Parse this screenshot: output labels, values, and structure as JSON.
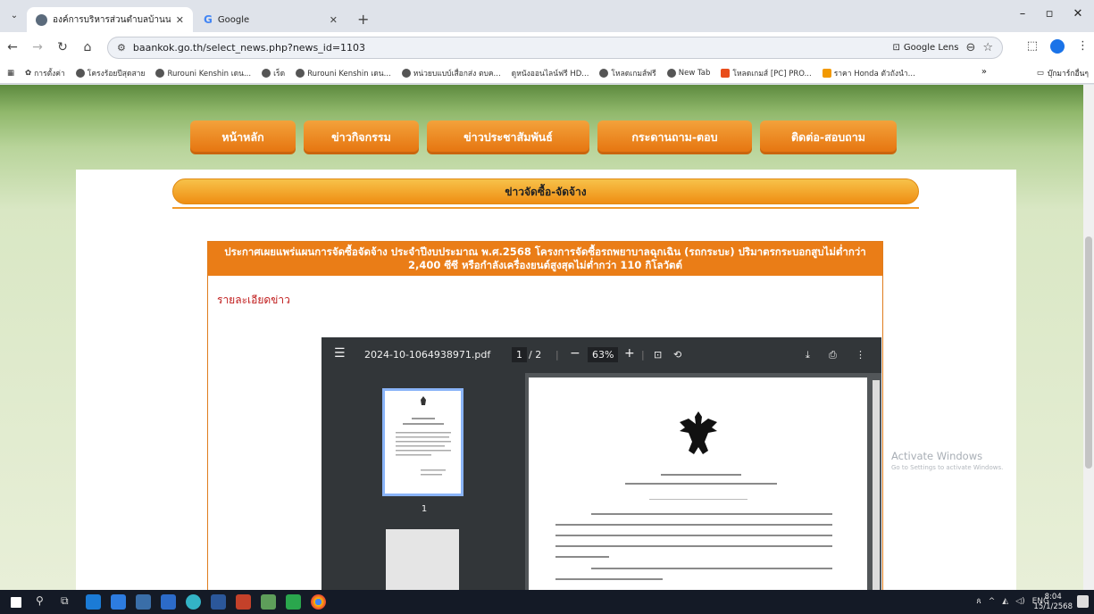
{
  "browser": {
    "tabs": [
      {
        "title": "องค์การบริหารส่วนตำบลบ้านนอก อ.",
        "active": true
      },
      {
        "title": "Google",
        "active": false
      }
    ],
    "url": "baankok.go.th/select_news.php?news_id=1103",
    "lens_label": "Google Lens",
    "bookmarks": [
      "การตั้งค่า",
      "โครงร้อยปีสุดสาย",
      "Rurouni Kenshin เดน...",
      "เร็ด",
      "Rurouni Kenshin เดน...",
      "หน่วยบแบบ์เสื่อกส่ง ตบค...",
      "ดูหนังออนไลน์ฟรี HD...",
      "โหลดเกมส์ฟรี",
      "New Tab",
      "โหลดเกมส์ [PC] PRO...",
      "ราคา Honda ตัวถังนำ..."
    ],
    "bookmarks_more": "»",
    "bookmarks_folder": "บุ๊กมาร์กอื่นๆ"
  },
  "site": {
    "menu": [
      "หน้าหลัก",
      "ข่าวกิจกรรม",
      "ข่าวประชาสัมพันธ์",
      "กระดานถาม-ตอบ",
      "ติดต่อ-สอบถาม"
    ],
    "section_title": "ข่าวจัดซื้อ-จัดจ้าง",
    "news_title": "ประกาศเผยแพร่แผนการจัดซื้อจัดจ้าง ประจำปีงบประมาณ พ.ศ.2568 โครงการจัดซื้อรถพยาบาลฉุกเฉิน (รถกระบะ) ปริมาตรกระบอกสูบไม่ต่ำกว่า 2,400 ซีซี หรือกำลังเครื่องยนต์สูงสุดไม่ต่ำกว่า 110 กิโลวัตต์",
    "detail_label": "รายละเอียดข่าว"
  },
  "pdf": {
    "filename": "2024-10-1064938971.pdf",
    "page_current": "1",
    "page_total": "/ 2",
    "zoom": "63%",
    "thumb_label": "1"
  },
  "os": {
    "watermark_title": "Activate Windows",
    "watermark_sub": "Go to Settings to activate Windows.",
    "lang": "ENG",
    "time": "8:04",
    "date": "15/1/2568"
  }
}
